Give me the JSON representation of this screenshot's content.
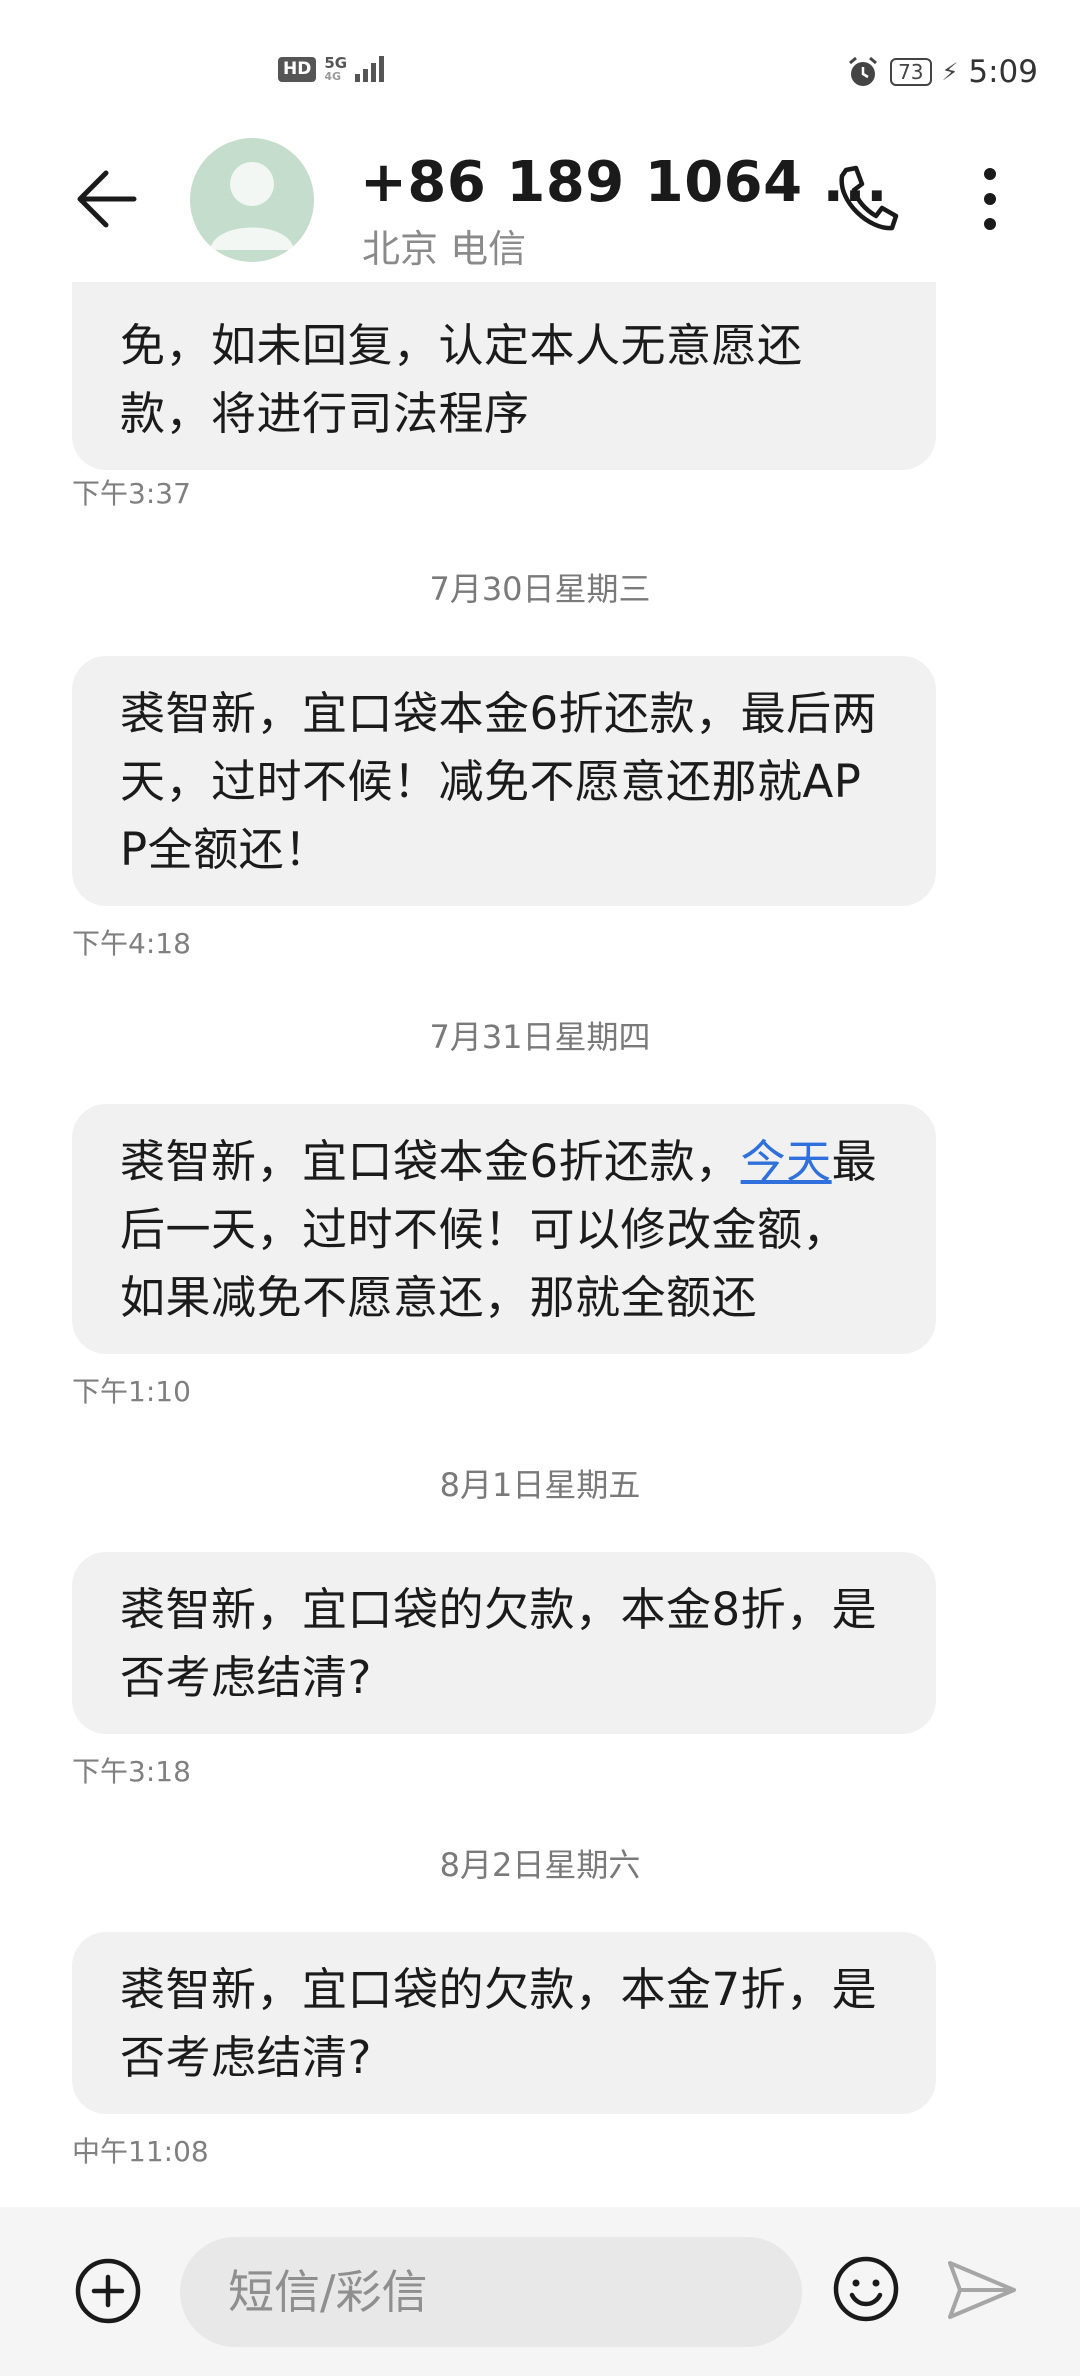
{
  "status_bar": {
    "hd": "HD",
    "network": "5G",
    "network_sub": "4G",
    "battery": "73",
    "time": "5:09"
  },
  "header": {
    "contact": "+86 189 1064 ...",
    "subtitle": "北京 电信",
    "back_icon": "arrow-left-icon",
    "call_icon": "phone-icon",
    "more_icon": "more-vertical-icon"
  },
  "messages": [
    {
      "text": "免，如未回复，认定本人无意愿还款，将进行司法程序",
      "time": "下午3:37"
    },
    {
      "date": "7月30日星期三",
      "text": "裘智新，宜口袋本金6折还款，最后两天，过时不候！减免不愿意还那就APP全额还！",
      "time": "下午4:18"
    },
    {
      "date": "7月31日星期四",
      "text_before": "裘智新，宜口袋本金6折还款，",
      "link": "今天",
      "text_after": "最后一天，过时不候！可以修改金额，如果减免不愿意还，那就全额还",
      "time": "下午1:10"
    },
    {
      "date": "8月1日星期五",
      "text": "裘智新，宜口袋的欠款，本金8折，是否考虑结清?",
      "time": "下午3:18"
    },
    {
      "date": "8月2日星期六",
      "text": "裘智新，宜口袋的欠款，本金7折，是否考虑结清?",
      "time": "中午11:08"
    }
  ],
  "input_bar": {
    "placeholder": "短信/彩信",
    "add_icon": "plus-circle-icon",
    "emoji_icon": "smiley-icon",
    "send_icon": "send-icon"
  },
  "colors": {
    "bubble": "#f1f1f1",
    "link": "#2f70dc",
    "avatar": "#c5ddcc"
  }
}
